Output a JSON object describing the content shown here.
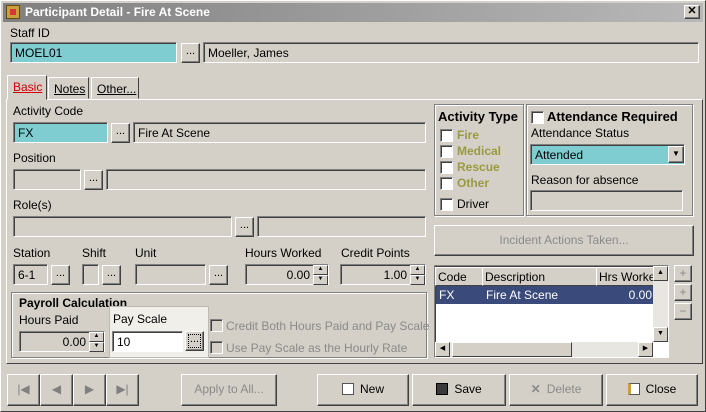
{
  "window": {
    "title": "Participant Detail  - Fire At Scene",
    "close_label": "✕"
  },
  "staff": {
    "label": "Staff ID",
    "id": "MOEL01",
    "name": "Moeller, James",
    "ellipsis": "..."
  },
  "tabs": [
    {
      "label": "Basic"
    },
    {
      "label": "Notes"
    },
    {
      "label": "Other..."
    }
  ],
  "activity_code": {
    "label": "Activity Code",
    "code": "FX",
    "description": "Fire At Scene"
  },
  "position": {
    "label": "Position",
    "value": "",
    "description": ""
  },
  "roles": {
    "label": "Role(s)",
    "value": "",
    "description": ""
  },
  "station": {
    "label": "Station",
    "value": "6-1"
  },
  "shift": {
    "label": "Shift",
    "value": ""
  },
  "unit": {
    "label": "Unit",
    "value": ""
  },
  "hours_worked": {
    "label": "Hours Worked",
    "value": "0.00"
  },
  "credit_points": {
    "label": "Credit Points",
    "value": "1.00"
  },
  "activity_type": {
    "title": "Activity Type",
    "options": [
      {
        "label": "Fire"
      },
      {
        "label": "Medical"
      },
      {
        "label": "Rescue"
      },
      {
        "label": "Other"
      }
    ],
    "driver_label": "Driver"
  },
  "attendance": {
    "required_label": "Attendance Required",
    "status_label": "Attendance Status",
    "status_value": "Attended",
    "reason_label": "Reason for absence",
    "reason_value": ""
  },
  "incident_actions_button": "Incident Actions Taken...",
  "grid": {
    "columns": [
      "Code",
      "Description",
      "Hrs Worked"
    ],
    "rows": [
      {
        "code": "FX",
        "description": "Fire At Scene",
        "hours": "0.00"
      }
    ]
  },
  "grid_side_buttons": [
    "+",
    "+",
    "−"
  ],
  "payroll": {
    "title": "Payroll Calculation",
    "hours_paid_label": "Hours Paid",
    "hours_paid_value": "0.00",
    "pay_scale_label": "Pay Scale",
    "pay_scale_value": "10",
    "credit_both_label": "Credit Both Hours Paid and Pay Scale",
    "use_pay_scale_label": "Use Pay Scale as the Hourly Rate"
  },
  "footer": {
    "nav": [
      "|◀",
      "◀",
      "▶",
      "▶|"
    ],
    "apply_all": "Apply to All...",
    "new": "New",
    "save": "Save",
    "delete": "Delete",
    "close": "Close"
  },
  "colors": {
    "field_highlight": "#7fcdd0",
    "selected_row": "#3a4a7a",
    "active_tab": "#cc0000"
  }
}
